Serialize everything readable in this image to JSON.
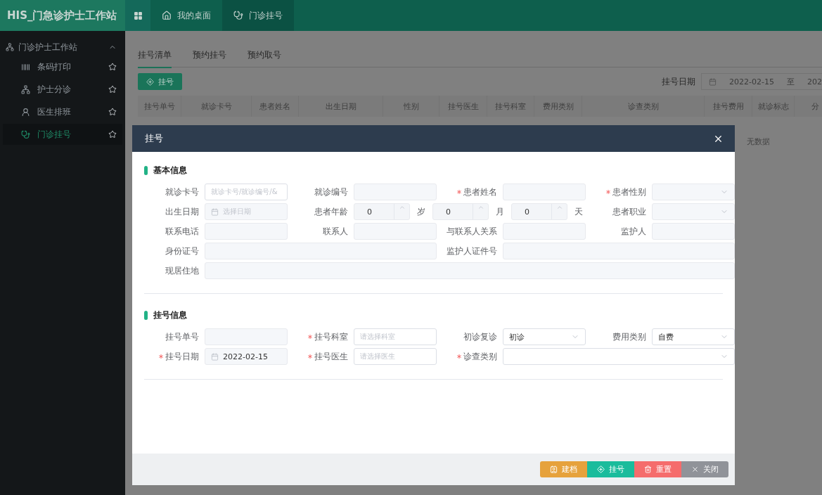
{
  "header": {
    "title": "HIS_门急诊护士工作站",
    "tabs": [
      {
        "label": "我的桌面",
        "selected": false
      },
      {
        "label": "门诊挂号",
        "selected": true
      }
    ]
  },
  "sidebar": {
    "group": {
      "label": "门诊护士工作站",
      "expanded": true
    },
    "items": [
      {
        "label": "条码打印",
        "selected": false
      },
      {
        "label": "护士分诊",
        "selected": false
      },
      {
        "label": "医生排班",
        "selected": false
      },
      {
        "label": "门诊挂号",
        "selected": true
      }
    ]
  },
  "page": {
    "tabs": [
      {
        "label": "挂号清单",
        "selected": true
      },
      {
        "label": "预约挂号",
        "selected": false
      },
      {
        "label": "预约取号",
        "selected": false
      }
    ],
    "add_button": "挂号",
    "date_filter": {
      "label": "挂号日期",
      "start": "2022-02-15",
      "separator": "至",
      "end": "202"
    },
    "table": {
      "columns": [
        "挂号单号",
        "就诊卡号",
        "患者姓名",
        "出生日期",
        "性别",
        "挂号医生",
        "挂号科室",
        "费用类别",
        "诊查类别",
        "挂号费用",
        "就诊标志",
        "分"
      ],
      "empty_text": "无数据"
    }
  },
  "dialog": {
    "title": "挂号",
    "sections": [
      {
        "title": "基本信息",
        "fields": [
          {
            "label": "就诊卡号",
            "kind": "text",
            "required": false,
            "disabled": false,
            "placeholder": "就诊卡号/就诊编号/&"
          },
          {
            "label": "就诊编号",
            "kind": "text",
            "required": false,
            "disabled": true
          },
          {
            "label": "患者姓名",
            "kind": "text",
            "required": true,
            "disabled": true
          },
          {
            "label": "患者性别",
            "kind": "select",
            "required": true,
            "disabled": true
          },
          {
            "label": "出生日期",
            "kind": "date",
            "required": false,
            "disabled": true,
            "placeholder": "选择日期"
          },
          {
            "label": "患者年龄",
            "kind": "age",
            "required": false,
            "disabled": true,
            "parts": [
              {
                "value": "0",
                "unit": "岁"
              },
              {
                "value": "0",
                "unit": "月"
              },
              {
                "value": "0",
                "unit": "天"
              }
            ]
          },
          {
            "label": "患者职业",
            "kind": "select",
            "required": false,
            "disabled": true
          },
          {
            "label": "联系电话",
            "kind": "text",
            "required": false,
            "disabled": true
          },
          {
            "label": "联系人",
            "kind": "text",
            "required": false,
            "disabled": true
          },
          {
            "label": "与联系人关系",
            "kind": "text",
            "required": false,
            "disabled": true
          },
          {
            "label": "监护人",
            "kind": "text",
            "required": false,
            "disabled": true
          },
          {
            "label": "身份证号",
            "kind": "text",
            "required": false,
            "disabled": true
          },
          {
            "label": "监护人证件号",
            "kind": "text",
            "required": false,
            "disabled": true
          },
          {
            "label": "现居住地",
            "kind": "text",
            "required": false,
            "disabled": true
          }
        ]
      },
      {
        "title": "挂号信息",
        "fields": [
          {
            "label": "挂号单号",
            "kind": "text",
            "required": false,
            "disabled": true
          },
          {
            "label": "挂号科室",
            "kind": "text",
            "required": true,
            "disabled": false,
            "placeholder": "请选择科室"
          },
          {
            "label": "初诊复诊",
            "kind": "select",
            "required": false,
            "disabled": false,
            "value": "初诊"
          },
          {
            "label": "费用类别",
            "kind": "select",
            "required": false,
            "disabled": false,
            "value": "自费"
          },
          {
            "label": "挂号日期",
            "kind": "date",
            "required": true,
            "disabled": true,
            "value": "2022-02-15"
          },
          {
            "label": "挂号医生",
            "kind": "text",
            "required": true,
            "disabled": false,
            "placeholder": "请选择医生"
          },
          {
            "label": "诊查类别",
            "kind": "select",
            "required": true,
            "disabled": false
          }
        ]
      }
    ],
    "buttons": [
      {
        "label": "建档",
        "kind": "archive"
      },
      {
        "label": "挂号",
        "kind": "register"
      },
      {
        "label": "重置",
        "kind": "reset"
      },
      {
        "label": "关闭",
        "kind": "close"
      }
    ]
  }
}
